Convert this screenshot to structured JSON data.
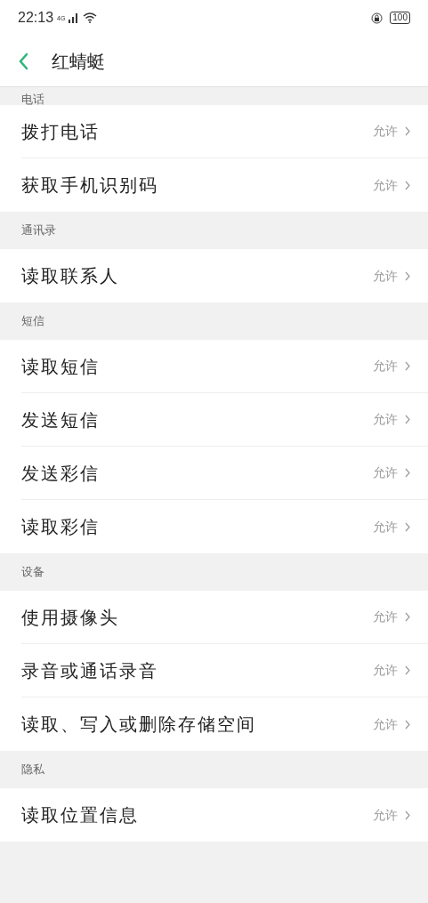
{
  "status_bar": {
    "time": "22:13",
    "network": "4G",
    "battery": "100"
  },
  "header": {
    "title": "红蜻蜓"
  },
  "sections": [
    {
      "title": "电话",
      "items": [
        {
          "label": "拨打电话",
          "value": "允许"
        },
        {
          "label": "获取手机识别码",
          "value": "允许"
        }
      ]
    },
    {
      "title": "通讯录",
      "items": [
        {
          "label": "读取联系人",
          "value": "允许"
        }
      ]
    },
    {
      "title": "短信",
      "items": [
        {
          "label": "读取短信",
          "value": "允许"
        },
        {
          "label": "发送短信",
          "value": "允许"
        },
        {
          "label": "发送彩信",
          "value": "允许"
        },
        {
          "label": "读取彩信",
          "value": "允许"
        }
      ]
    },
    {
      "title": "设备",
      "items": [
        {
          "label": "使用摄像头",
          "value": "允许"
        },
        {
          "label": "录音或通话录音",
          "value": "允许"
        },
        {
          "label": "读取、写入或删除存储空间",
          "value": "允许"
        }
      ]
    },
    {
      "title": "隐私",
      "items": [
        {
          "label": "读取位置信息",
          "value": "允许"
        }
      ]
    }
  ]
}
